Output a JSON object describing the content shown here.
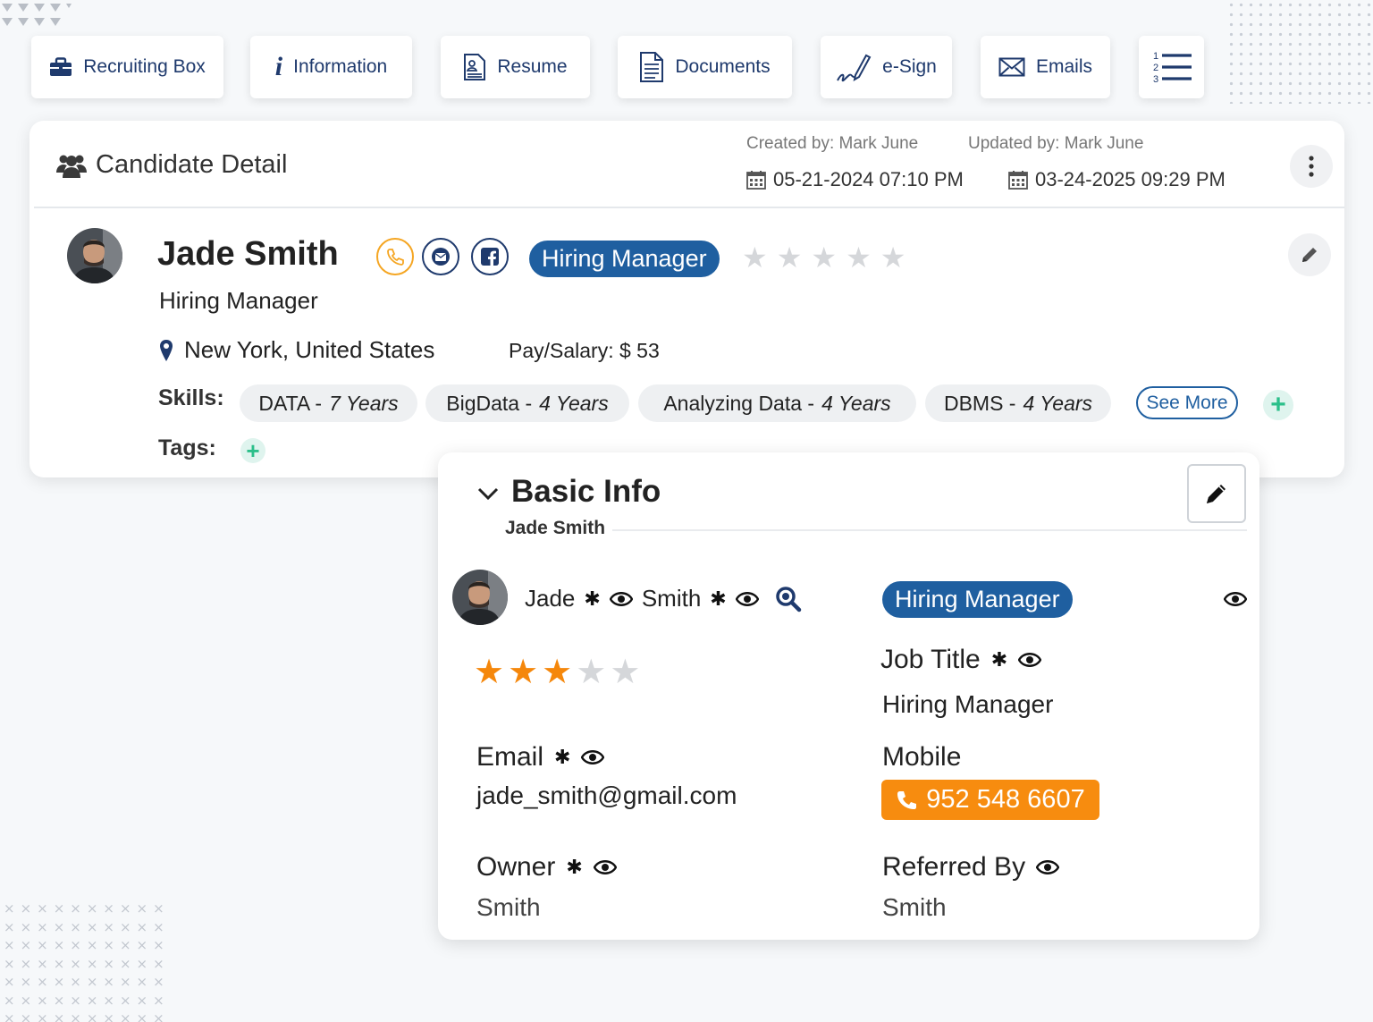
{
  "toolbar": {
    "tabs": [
      {
        "label": "Recruiting Box",
        "icon": "briefcase-icon"
      },
      {
        "label": "Information",
        "icon": "info-icon"
      },
      {
        "label": "Resume",
        "icon": "resume-icon"
      },
      {
        "label": "Documents",
        "icon": "document-icon"
      },
      {
        "label": "e-Sign",
        "icon": "pen-signature-icon"
      },
      {
        "label": "Emails",
        "icon": "envelope-icon"
      },
      {
        "label": "",
        "icon": "numbered-list-icon"
      }
    ],
    "list_numbers": [
      "1",
      "2",
      "3"
    ]
  },
  "candidate_detail": {
    "title": "Candidate Detail",
    "created_by": "Created by: Mark June",
    "updated_by": "Updated by: Mark June",
    "created_date": "05-21-2024 07:10 PM",
    "updated_date": "03-24-2025 09:29 PM",
    "name": "Jade Smith",
    "role_badge": "Hiring Manager",
    "job_title": "Hiring Manager",
    "location": "New York, United States",
    "pay_label": "Pay/Salary:",
    "pay_value": "$ 53",
    "rating": 0,
    "rating_max": 5,
    "skills_label": "Skills:",
    "skills": [
      {
        "name": "DATA -",
        "years": "7 Years"
      },
      {
        "name": "BigData -",
        "years": "4 Years"
      },
      {
        "name": "Analyzing Data -",
        "years": "4 Years"
      },
      {
        "name": "DBMS -",
        "years": "4 Years"
      }
    ],
    "see_more": "See More",
    "tags_label": "Tags:",
    "colors": {
      "accent": "#1f5fa0",
      "phone": "#f5a623",
      "add": "#2bbf8a"
    }
  },
  "basic_info": {
    "title": "Basic Info",
    "subtitle": "Jade Smith",
    "first_name": "Jade",
    "last_name": "Smith",
    "role_badge": "Hiring Manager",
    "rating": 3,
    "rating_max": 5,
    "star_color": "#f5870b",
    "job_title_label": "Job Title",
    "job_title_value": "Hiring Manager",
    "email_label": "Email",
    "email_value": "jade_smith@gmail.com",
    "mobile_label": "Mobile",
    "mobile_value": "952 548 6607",
    "owner_label": "Owner",
    "owner_value": "Smith",
    "referred_label": "Referred By",
    "referred_value": "Smith",
    "phone_color": "#f78c0f"
  }
}
